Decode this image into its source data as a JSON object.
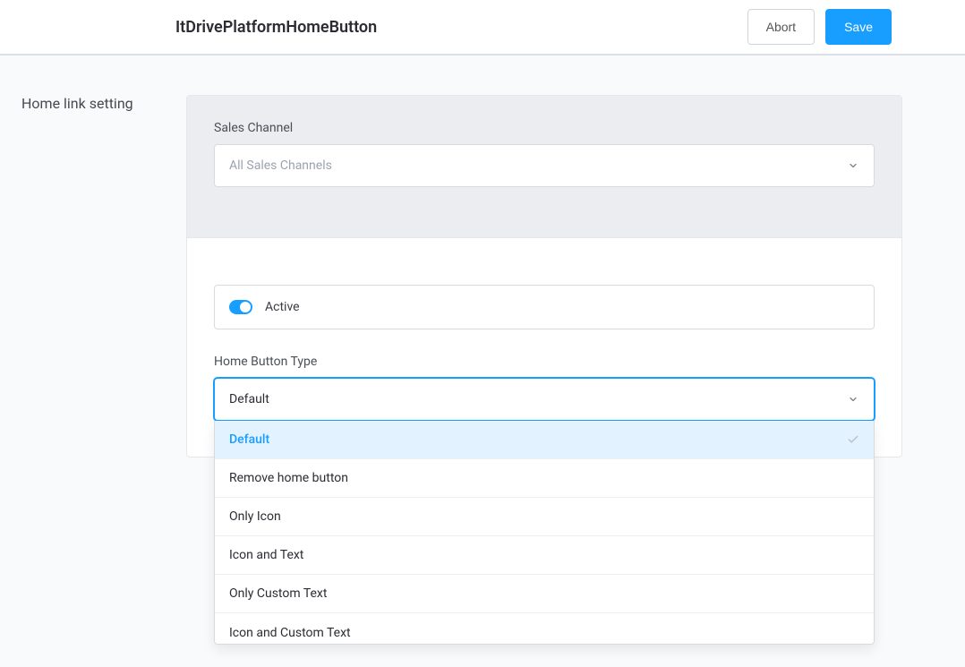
{
  "header": {
    "title": "ItDrivePlatformHomeButton",
    "abort_label": "Abort",
    "save_label": "Save"
  },
  "sidebar": {
    "section_title": "Home link setting"
  },
  "sales_channel": {
    "label": "Sales Channel",
    "placeholder": "All Sales Channels"
  },
  "active_toggle": {
    "label": "Active",
    "on": true
  },
  "button_type": {
    "label": "Home Button Type",
    "value": "Default",
    "options": [
      "Default",
      "Remove home button",
      "Only Icon",
      "Icon and Text",
      "Only Custom Text",
      "Icon and Custom Text"
    ],
    "selected_index": 0
  }
}
